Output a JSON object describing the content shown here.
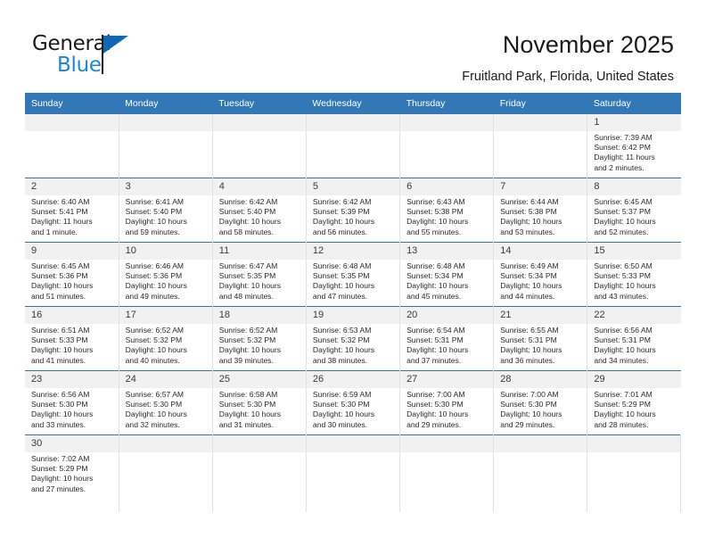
{
  "brand": {
    "name_top": "General",
    "name_bottom": "Blue",
    "color_black": "#1b1b1b",
    "color_blue": "#1e86d0"
  },
  "header": {
    "title": "November 2025",
    "subtitle": "Fruitland Park, Florida, United States",
    "header_bg": "#3277b6",
    "daynum_bg": "#f1f1f1"
  },
  "weekday_headers": [
    "Sunday",
    "Monday",
    "Tuesday",
    "Wednesday",
    "Thursday",
    "Friday",
    "Saturday"
  ],
  "weeks": [
    [
      {
        "day": "",
        "sunrise": "",
        "sunset": "",
        "daylight_line1": "",
        "daylight_line2": ""
      },
      {
        "day": "",
        "sunrise": "",
        "sunset": "",
        "daylight_line1": "",
        "daylight_line2": ""
      },
      {
        "day": "",
        "sunrise": "",
        "sunset": "",
        "daylight_line1": "",
        "daylight_line2": ""
      },
      {
        "day": "",
        "sunrise": "",
        "sunset": "",
        "daylight_line1": "",
        "daylight_line2": ""
      },
      {
        "day": "",
        "sunrise": "",
        "sunset": "",
        "daylight_line1": "",
        "daylight_line2": ""
      },
      {
        "day": "",
        "sunrise": "",
        "sunset": "",
        "daylight_line1": "",
        "daylight_line2": ""
      },
      {
        "day": "1",
        "sunrise": "Sunrise: 7:39 AM",
        "sunset": "Sunset: 6:42 PM",
        "daylight_line1": "Daylight: 11 hours",
        "daylight_line2": "and 2 minutes."
      }
    ],
    [
      {
        "day": "2",
        "sunrise": "Sunrise: 6:40 AM",
        "sunset": "Sunset: 5:41 PM",
        "daylight_line1": "Daylight: 11 hours",
        "daylight_line2": "and 1 minute."
      },
      {
        "day": "3",
        "sunrise": "Sunrise: 6:41 AM",
        "sunset": "Sunset: 5:40 PM",
        "daylight_line1": "Daylight: 10 hours",
        "daylight_line2": "and 59 minutes."
      },
      {
        "day": "4",
        "sunrise": "Sunrise: 6:42 AM",
        "sunset": "Sunset: 5:40 PM",
        "daylight_line1": "Daylight: 10 hours",
        "daylight_line2": "and 58 minutes."
      },
      {
        "day": "5",
        "sunrise": "Sunrise: 6:42 AM",
        "sunset": "Sunset: 5:39 PM",
        "daylight_line1": "Daylight: 10 hours",
        "daylight_line2": "and 56 minutes."
      },
      {
        "day": "6",
        "sunrise": "Sunrise: 6:43 AM",
        "sunset": "Sunset: 5:38 PM",
        "daylight_line1": "Daylight: 10 hours",
        "daylight_line2": "and 55 minutes."
      },
      {
        "day": "7",
        "sunrise": "Sunrise: 6:44 AM",
        "sunset": "Sunset: 5:38 PM",
        "daylight_line1": "Daylight: 10 hours",
        "daylight_line2": "and 53 minutes."
      },
      {
        "day": "8",
        "sunrise": "Sunrise: 6:45 AM",
        "sunset": "Sunset: 5:37 PM",
        "daylight_line1": "Daylight: 10 hours",
        "daylight_line2": "and 52 minutes."
      }
    ],
    [
      {
        "day": "9",
        "sunrise": "Sunrise: 6:45 AM",
        "sunset": "Sunset: 5:36 PM",
        "daylight_line1": "Daylight: 10 hours",
        "daylight_line2": "and 51 minutes."
      },
      {
        "day": "10",
        "sunrise": "Sunrise: 6:46 AM",
        "sunset": "Sunset: 5:36 PM",
        "daylight_line1": "Daylight: 10 hours",
        "daylight_line2": "and 49 minutes."
      },
      {
        "day": "11",
        "sunrise": "Sunrise: 6:47 AM",
        "sunset": "Sunset: 5:35 PM",
        "daylight_line1": "Daylight: 10 hours",
        "daylight_line2": "and 48 minutes."
      },
      {
        "day": "12",
        "sunrise": "Sunrise: 6:48 AM",
        "sunset": "Sunset: 5:35 PM",
        "daylight_line1": "Daylight: 10 hours",
        "daylight_line2": "and 47 minutes."
      },
      {
        "day": "13",
        "sunrise": "Sunrise: 6:48 AM",
        "sunset": "Sunset: 5:34 PM",
        "daylight_line1": "Daylight: 10 hours",
        "daylight_line2": "and 45 minutes."
      },
      {
        "day": "14",
        "sunrise": "Sunrise: 6:49 AM",
        "sunset": "Sunset: 5:34 PM",
        "daylight_line1": "Daylight: 10 hours",
        "daylight_line2": "and 44 minutes."
      },
      {
        "day": "15",
        "sunrise": "Sunrise: 6:50 AM",
        "sunset": "Sunset: 5:33 PM",
        "daylight_line1": "Daylight: 10 hours",
        "daylight_line2": "and 43 minutes."
      }
    ],
    [
      {
        "day": "16",
        "sunrise": "Sunrise: 6:51 AM",
        "sunset": "Sunset: 5:33 PM",
        "daylight_line1": "Daylight: 10 hours",
        "daylight_line2": "and 41 minutes."
      },
      {
        "day": "17",
        "sunrise": "Sunrise: 6:52 AM",
        "sunset": "Sunset: 5:32 PM",
        "daylight_line1": "Daylight: 10 hours",
        "daylight_line2": "and 40 minutes."
      },
      {
        "day": "18",
        "sunrise": "Sunrise: 6:52 AM",
        "sunset": "Sunset: 5:32 PM",
        "daylight_line1": "Daylight: 10 hours",
        "daylight_line2": "and 39 minutes."
      },
      {
        "day": "19",
        "sunrise": "Sunrise: 6:53 AM",
        "sunset": "Sunset: 5:32 PM",
        "daylight_line1": "Daylight: 10 hours",
        "daylight_line2": "and 38 minutes."
      },
      {
        "day": "20",
        "sunrise": "Sunrise: 6:54 AM",
        "sunset": "Sunset: 5:31 PM",
        "daylight_line1": "Daylight: 10 hours",
        "daylight_line2": "and 37 minutes."
      },
      {
        "day": "21",
        "sunrise": "Sunrise: 6:55 AM",
        "sunset": "Sunset: 5:31 PM",
        "daylight_line1": "Daylight: 10 hours",
        "daylight_line2": "and 36 minutes."
      },
      {
        "day": "22",
        "sunrise": "Sunrise: 6:56 AM",
        "sunset": "Sunset: 5:31 PM",
        "daylight_line1": "Daylight: 10 hours",
        "daylight_line2": "and 34 minutes."
      }
    ],
    [
      {
        "day": "23",
        "sunrise": "Sunrise: 6:56 AM",
        "sunset": "Sunset: 5:30 PM",
        "daylight_line1": "Daylight: 10 hours",
        "daylight_line2": "and 33 minutes."
      },
      {
        "day": "24",
        "sunrise": "Sunrise: 6:57 AM",
        "sunset": "Sunset: 5:30 PM",
        "daylight_line1": "Daylight: 10 hours",
        "daylight_line2": "and 32 minutes."
      },
      {
        "day": "25",
        "sunrise": "Sunrise: 6:58 AM",
        "sunset": "Sunset: 5:30 PM",
        "daylight_line1": "Daylight: 10 hours",
        "daylight_line2": "and 31 minutes."
      },
      {
        "day": "26",
        "sunrise": "Sunrise: 6:59 AM",
        "sunset": "Sunset: 5:30 PM",
        "daylight_line1": "Daylight: 10 hours",
        "daylight_line2": "and 30 minutes."
      },
      {
        "day": "27",
        "sunrise": "Sunrise: 7:00 AM",
        "sunset": "Sunset: 5:30 PM",
        "daylight_line1": "Daylight: 10 hours",
        "daylight_line2": "and 29 minutes."
      },
      {
        "day": "28",
        "sunrise": "Sunrise: 7:00 AM",
        "sunset": "Sunset: 5:30 PM",
        "daylight_line1": "Daylight: 10 hours",
        "daylight_line2": "and 29 minutes."
      },
      {
        "day": "29",
        "sunrise": "Sunrise: 7:01 AM",
        "sunset": "Sunset: 5:29 PM",
        "daylight_line1": "Daylight: 10 hours",
        "daylight_line2": "and 28 minutes."
      }
    ],
    [
      {
        "day": "30",
        "sunrise": "Sunrise: 7:02 AM",
        "sunset": "Sunset: 5:29 PM",
        "daylight_line1": "Daylight: 10 hours",
        "daylight_line2": "and 27 minutes."
      },
      {
        "day": "",
        "sunrise": "",
        "sunset": "",
        "daylight_line1": "",
        "daylight_line2": ""
      },
      {
        "day": "",
        "sunrise": "",
        "sunset": "",
        "daylight_line1": "",
        "daylight_line2": ""
      },
      {
        "day": "",
        "sunrise": "",
        "sunset": "",
        "daylight_line1": "",
        "daylight_line2": ""
      },
      {
        "day": "",
        "sunrise": "",
        "sunset": "",
        "daylight_line1": "",
        "daylight_line2": ""
      },
      {
        "day": "",
        "sunrise": "",
        "sunset": "",
        "daylight_line1": "",
        "daylight_line2": ""
      },
      {
        "day": "",
        "sunrise": "",
        "sunset": "",
        "daylight_line1": "",
        "daylight_line2": ""
      }
    ]
  ]
}
